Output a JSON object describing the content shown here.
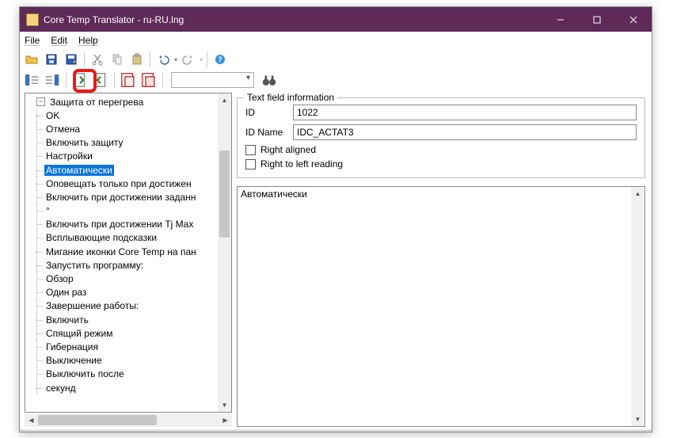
{
  "window": {
    "title": "Core Temp Translator - ru-RU.lng"
  },
  "menu": {
    "file": "File",
    "edit": "Edit",
    "help": "Help"
  },
  "tree": {
    "root": "Защита от перегрева",
    "items": [
      "OK",
      "Отмена",
      "Включить защиту",
      "Настройки",
      "Автоматически",
      "Оповещать только при достижен",
      "Включить при достижении заданн",
      "°",
      "Включить при достижении Tj Max",
      "Всплывающие подсказки",
      "Мигание иконки Core Temp на пан",
      "Запустить программу:",
      "Обзор",
      "Один раз",
      "Завершение работы:",
      "Включить",
      "Спящий режим",
      "Гибернация",
      "Выключение",
      "Выключить после",
      "секунд"
    ],
    "selectedIndex": 4
  },
  "info": {
    "legend": "Text field information",
    "idLabel": "ID",
    "idValue": "1022",
    "idNameLabel": "ID Name",
    "idNameValue": "IDC_ACTAT3",
    "rightAligned": "Right aligned",
    "rtl": "Right to left reading"
  },
  "editor": {
    "text": "Автоматически"
  }
}
